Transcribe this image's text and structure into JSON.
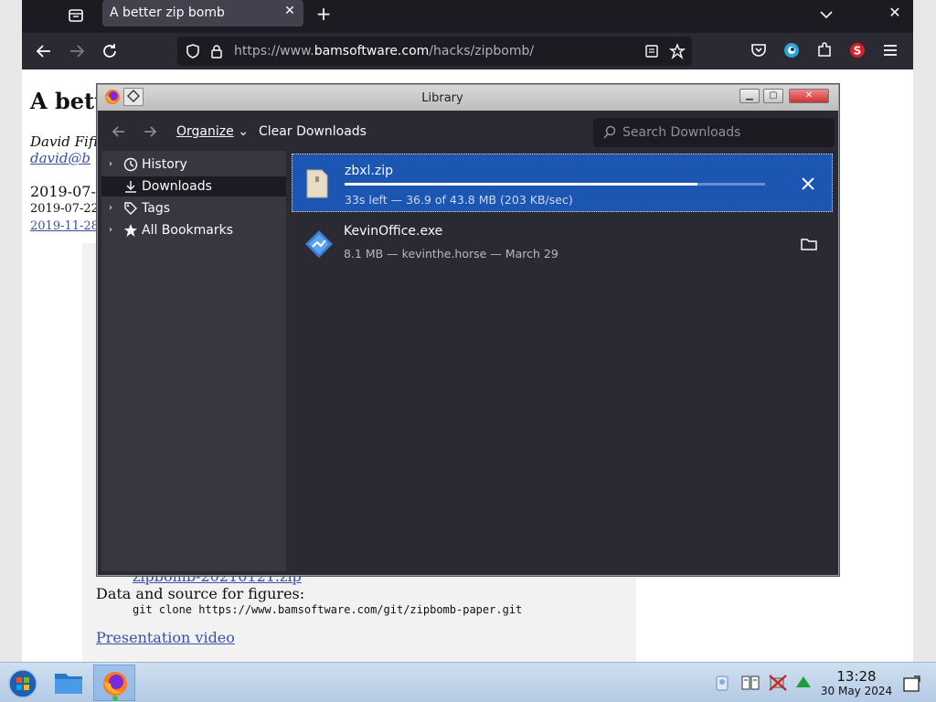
{
  "browser": {
    "tab_title": "A better zip bomb",
    "url_prefix": "https://www.",
    "url_host": "bamsoftware.com",
    "url_path": "/hacks/zipbomb/"
  },
  "page": {
    "heading": "A better zip bomb",
    "author": "David Fifi",
    "email": "david@b",
    "date1": "2019-07-",
    "date2": "2019-07-22",
    "date3": "2019-11-28",
    "zip_link": "zipbomb-20210121.zip",
    "data_source": "Data and source for figures:",
    "git_cmd": "git clone https://www.bamsoftware.com/git/zipbomb-paper.git",
    "presentation": "Presentation video"
  },
  "library": {
    "title": "Library",
    "toolbar": {
      "organize": "Organize",
      "clear_downloads": "Clear Downloads",
      "search_placeholder": "Search Downloads"
    },
    "sidebar": [
      {
        "label": "History",
        "icon": "clock-icon",
        "expandable": true
      },
      {
        "label": "Downloads",
        "icon": "download-icon",
        "expandable": false,
        "selected": true
      },
      {
        "label": "Tags",
        "icon": "tag-icon",
        "expandable": true
      },
      {
        "label": "All Bookmarks",
        "icon": "star-icon",
        "expandable": true
      }
    ],
    "downloads": [
      {
        "name": "zbxl.zip",
        "status": "33s left — 36.9 of 43.8 MB (203 KB/sec)",
        "progress": 0.84,
        "action": "cancel-icon"
      },
      {
        "name": "KevinOffice.exe",
        "status": "8.1 MB — kevinthe.horse — March 29",
        "action": "folder-icon"
      }
    ]
  },
  "taskbar": {
    "time": "13:28",
    "date": "30 May 2024"
  },
  "colors": {
    "selected_download": "#1a56b2",
    "dialog_bg": "#2b2a33",
    "sidebar_bg": "#38373f",
    "link": "#3b4fa8"
  }
}
